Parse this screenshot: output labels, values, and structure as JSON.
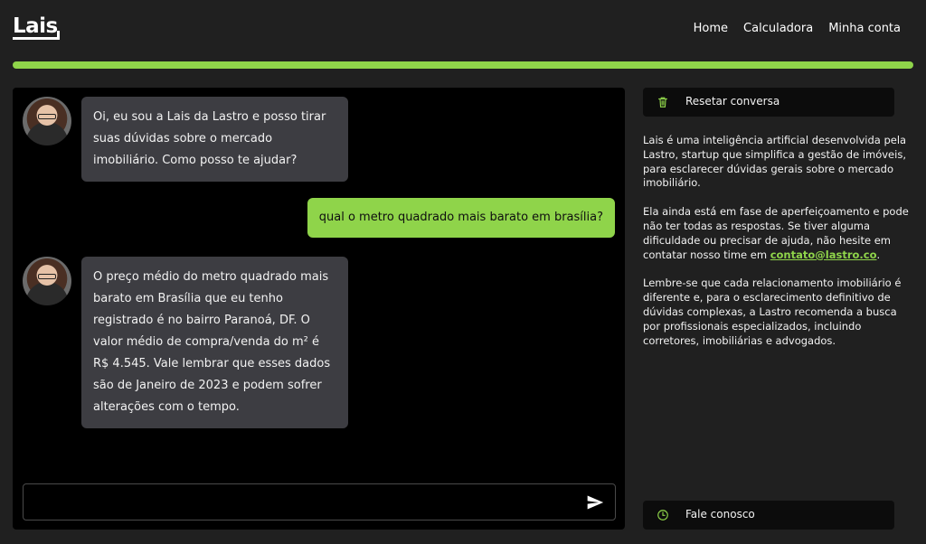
{
  "header": {
    "logo": "Lais",
    "nav": [
      "Home",
      "Calculadora",
      "Minha conta"
    ]
  },
  "chat": {
    "messages": [
      {
        "role": "bot",
        "text": "Oi, eu sou a Lais da Lastro e posso tirar suas dúvidas sobre o mercado imobiliário. Como posso te ajudar?"
      },
      {
        "role": "user",
        "text": "qual o metro quadrado mais barato em brasília?"
      },
      {
        "role": "bot",
        "text": "O preço médio do metro quadrado mais barato em Brasília que eu tenho registrado é no bairro Paranoá, DF. O valor médio de compra/venda do m² é R$ 4.545. Vale lembrar que esses dados são de Janeiro de 2023 e podem sofrer alterações com o tempo."
      }
    ],
    "input_value": "",
    "input_placeholder": "",
    "send_icon": "send-icon"
  },
  "sidebar": {
    "reset_label": "Resetar conversa",
    "reset_icon": "trash-icon",
    "info_p1": "Lais é uma inteligência artificial desenvolvida pela Lastro, startup que simplifica a gestão de imóveis, para esclarecer dúvidas gerais sobre o mercado imobiliário.",
    "info_p2_before": "Ela ainda está em fase de aperfeiçoamento e pode não ter todas as respostas. Se tiver alguma dificuldade ou precisar de ajuda, não hesite em contatar nosso time em ",
    "info_p2_link": "contato@lastro.co",
    "info_p2_after": ".",
    "info_p3": "Lembre-se que cada relacionamento imobiliário é diferente e, para o esclarecimento definitivo de dúvidas complexas, a Lastro recomenda a busca por profissionais especializados, incluindo corretores, imobiliárias e advogados.",
    "contact_label": "Fale conosco",
    "contact_icon": "clock-icon"
  },
  "colors": {
    "accent": "#8fd44a",
    "background": "#202020",
    "chat_bg": "#000000",
    "bot_bubble": "#3d3d42"
  }
}
